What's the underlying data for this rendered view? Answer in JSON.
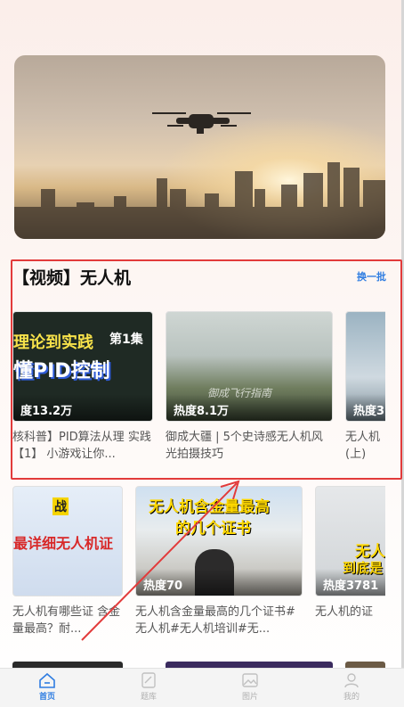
{
  "section": {
    "title": "【视频】无人机",
    "refresh_label": "换一批"
  },
  "row1": [
    {
      "heat": "度13.2万",
      "title": "核科普】PID算法从理 实践【1】 小游戏让你...",
      "thumb_text_1": "理论到实践",
      "thumb_text_2": "第1集",
      "thumb_text_3": "懂PID控制"
    },
    {
      "heat": "热度8.1万",
      "title": "御成大疆 | 5个史诗感无人机风光拍摄技巧",
      "thumb_text_1": "御成飞行指南"
    },
    {
      "heat": "热度3",
      "title": "无人机 (上)"
    }
  ],
  "row2": [
    {
      "title": "无人机有哪些证 含金量最高？耐...",
      "thumb_text_1": "战",
      "thumb_text_2": "最详细",
      "thumb_text_3": "无人机证"
    },
    {
      "heat": "热度70",
      "title": "无人机含金量最高的几个证书#无人机#无人机培训#无...",
      "thumb_text_1": "无人机含金量最高",
      "thumb_text_2": "的几个证书"
    },
    {
      "heat": "热度3781",
      "title": "无人机的证",
      "thumb_text_1": "无人",
      "thumb_text_2": "到底是"
    }
  ],
  "nav": [
    {
      "label": "首页",
      "icon": "home-icon",
      "active": true
    },
    {
      "label": "题库",
      "icon": "question-bank-icon",
      "active": false
    },
    {
      "label": "图片",
      "icon": "image-icon",
      "active": false
    },
    {
      "label": "我的",
      "icon": "user-icon",
      "active": false
    }
  ],
  "colors": {
    "accent": "#2f7de1",
    "highlight_box": "#e23b3b"
  }
}
